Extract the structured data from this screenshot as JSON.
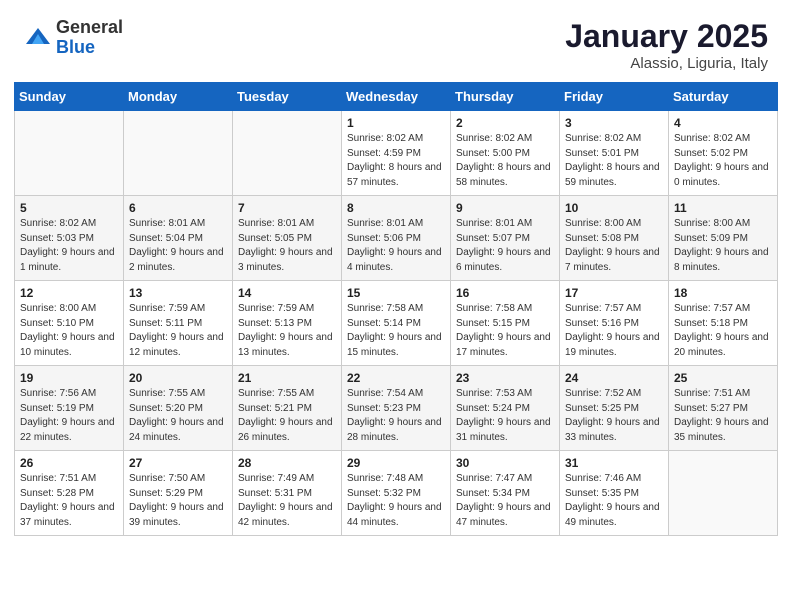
{
  "header": {
    "logo_general": "General",
    "logo_blue": "Blue",
    "title": "January 2025",
    "subtitle": "Alassio, Liguria, Italy"
  },
  "days_of_week": [
    "Sunday",
    "Monday",
    "Tuesday",
    "Wednesday",
    "Thursday",
    "Friday",
    "Saturday"
  ],
  "weeks": [
    [
      {
        "num": "",
        "info": ""
      },
      {
        "num": "",
        "info": ""
      },
      {
        "num": "",
        "info": ""
      },
      {
        "num": "1",
        "info": "Sunrise: 8:02 AM\nSunset: 4:59 PM\nDaylight: 8 hours and 57 minutes."
      },
      {
        "num": "2",
        "info": "Sunrise: 8:02 AM\nSunset: 5:00 PM\nDaylight: 8 hours and 58 minutes."
      },
      {
        "num": "3",
        "info": "Sunrise: 8:02 AM\nSunset: 5:01 PM\nDaylight: 8 hours and 59 minutes."
      },
      {
        "num": "4",
        "info": "Sunrise: 8:02 AM\nSunset: 5:02 PM\nDaylight: 9 hours and 0 minutes."
      }
    ],
    [
      {
        "num": "5",
        "info": "Sunrise: 8:02 AM\nSunset: 5:03 PM\nDaylight: 9 hours and 1 minute."
      },
      {
        "num": "6",
        "info": "Sunrise: 8:01 AM\nSunset: 5:04 PM\nDaylight: 9 hours and 2 minutes."
      },
      {
        "num": "7",
        "info": "Sunrise: 8:01 AM\nSunset: 5:05 PM\nDaylight: 9 hours and 3 minutes."
      },
      {
        "num": "8",
        "info": "Sunrise: 8:01 AM\nSunset: 5:06 PM\nDaylight: 9 hours and 4 minutes."
      },
      {
        "num": "9",
        "info": "Sunrise: 8:01 AM\nSunset: 5:07 PM\nDaylight: 9 hours and 6 minutes."
      },
      {
        "num": "10",
        "info": "Sunrise: 8:00 AM\nSunset: 5:08 PM\nDaylight: 9 hours and 7 minutes."
      },
      {
        "num": "11",
        "info": "Sunrise: 8:00 AM\nSunset: 5:09 PM\nDaylight: 9 hours and 8 minutes."
      }
    ],
    [
      {
        "num": "12",
        "info": "Sunrise: 8:00 AM\nSunset: 5:10 PM\nDaylight: 9 hours and 10 minutes."
      },
      {
        "num": "13",
        "info": "Sunrise: 7:59 AM\nSunset: 5:11 PM\nDaylight: 9 hours and 12 minutes."
      },
      {
        "num": "14",
        "info": "Sunrise: 7:59 AM\nSunset: 5:13 PM\nDaylight: 9 hours and 13 minutes."
      },
      {
        "num": "15",
        "info": "Sunrise: 7:58 AM\nSunset: 5:14 PM\nDaylight: 9 hours and 15 minutes."
      },
      {
        "num": "16",
        "info": "Sunrise: 7:58 AM\nSunset: 5:15 PM\nDaylight: 9 hours and 17 minutes."
      },
      {
        "num": "17",
        "info": "Sunrise: 7:57 AM\nSunset: 5:16 PM\nDaylight: 9 hours and 19 minutes."
      },
      {
        "num": "18",
        "info": "Sunrise: 7:57 AM\nSunset: 5:18 PM\nDaylight: 9 hours and 20 minutes."
      }
    ],
    [
      {
        "num": "19",
        "info": "Sunrise: 7:56 AM\nSunset: 5:19 PM\nDaylight: 9 hours and 22 minutes."
      },
      {
        "num": "20",
        "info": "Sunrise: 7:55 AM\nSunset: 5:20 PM\nDaylight: 9 hours and 24 minutes."
      },
      {
        "num": "21",
        "info": "Sunrise: 7:55 AM\nSunset: 5:21 PM\nDaylight: 9 hours and 26 minutes."
      },
      {
        "num": "22",
        "info": "Sunrise: 7:54 AM\nSunset: 5:23 PM\nDaylight: 9 hours and 28 minutes."
      },
      {
        "num": "23",
        "info": "Sunrise: 7:53 AM\nSunset: 5:24 PM\nDaylight: 9 hours and 31 minutes."
      },
      {
        "num": "24",
        "info": "Sunrise: 7:52 AM\nSunset: 5:25 PM\nDaylight: 9 hours and 33 minutes."
      },
      {
        "num": "25",
        "info": "Sunrise: 7:51 AM\nSunset: 5:27 PM\nDaylight: 9 hours and 35 minutes."
      }
    ],
    [
      {
        "num": "26",
        "info": "Sunrise: 7:51 AM\nSunset: 5:28 PM\nDaylight: 9 hours and 37 minutes."
      },
      {
        "num": "27",
        "info": "Sunrise: 7:50 AM\nSunset: 5:29 PM\nDaylight: 9 hours and 39 minutes."
      },
      {
        "num": "28",
        "info": "Sunrise: 7:49 AM\nSunset: 5:31 PM\nDaylight: 9 hours and 42 minutes."
      },
      {
        "num": "29",
        "info": "Sunrise: 7:48 AM\nSunset: 5:32 PM\nDaylight: 9 hours and 44 minutes."
      },
      {
        "num": "30",
        "info": "Sunrise: 7:47 AM\nSunset: 5:34 PM\nDaylight: 9 hours and 47 minutes."
      },
      {
        "num": "31",
        "info": "Sunrise: 7:46 AM\nSunset: 5:35 PM\nDaylight: 9 hours and 49 minutes."
      },
      {
        "num": "",
        "info": ""
      }
    ]
  ]
}
